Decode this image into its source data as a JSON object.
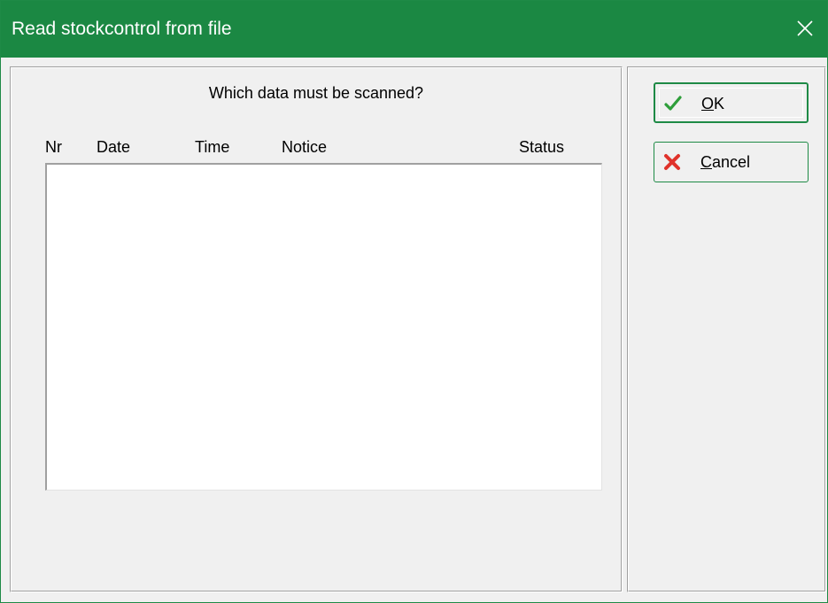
{
  "window": {
    "title": "Read stockcontrol from file",
    "close_glyph": "✕",
    "titlebar_color": "#1b8843"
  },
  "main": {
    "question": "Which data must be scanned?",
    "columns": [
      "Nr",
      "Date",
      "Time",
      "Notice",
      "Status"
    ],
    "rows": []
  },
  "buttons": {
    "ok": {
      "mnemonic": "O",
      "rest": "K",
      "icon": "checkmark-icon",
      "icon_color": "#2e9e3a"
    },
    "cancel": {
      "mnemonic": "C",
      "rest": "ancel",
      "icon": "x-icon",
      "icon_color": "#e0322b"
    }
  }
}
